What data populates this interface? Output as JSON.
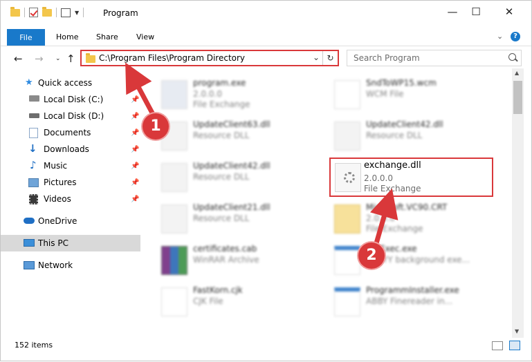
{
  "window": {
    "title": "Program",
    "controls": [
      "minimize-icon",
      "maximize-icon",
      "close-icon"
    ]
  },
  "ribbon": {
    "tabs": [
      "File",
      "Home",
      "Share",
      "View"
    ],
    "file_color": "#1979ca"
  },
  "address": {
    "path": "C:\\Program Files\\Program Directory",
    "highlight_color": "#d9383a"
  },
  "search": {
    "placeholder": "Search Program"
  },
  "nav": {
    "items": [
      {
        "label": "Quick access",
        "icon": "star-icon"
      },
      {
        "label": "Local Disk (C:)",
        "icon": "drive-icon",
        "pinned": true
      },
      {
        "label": "Local Disk (D:)",
        "icon": "drive-icon",
        "pinned": true
      },
      {
        "label": "Documents",
        "icon": "documents-icon",
        "pinned": true
      },
      {
        "label": "Downloads",
        "icon": "download-arrow-icon",
        "pinned": true
      },
      {
        "label": "Music",
        "icon": "music-note-icon",
        "pinned": true
      },
      {
        "label": "Pictures",
        "icon": "pictures-icon",
        "pinned": true
      },
      {
        "label": "Videos",
        "icon": "film-icon",
        "pinned": true
      },
      {
        "label": "OneDrive",
        "icon": "cloud-icon"
      },
      {
        "label": "This PC",
        "icon": "monitor-icon",
        "selected": true
      },
      {
        "label": "Network",
        "icon": "network-icon"
      }
    ]
  },
  "files": {
    "left": [
      {
        "name": "program.exe",
        "sub1": "2.0.0.0",
        "sub2": "File Exchange"
      },
      {
        "name": "UpdateClient63.dll",
        "sub1": "Resource DLL",
        "sub2": ""
      },
      {
        "name": "UpdateClient42.dll",
        "sub1": "Resource DLL",
        "sub2": ""
      },
      {
        "name": "UpdateClient21.dll",
        "sub1": "Resource DLL",
        "sub2": ""
      },
      {
        "name": "certificates.cab",
        "sub1": "WinRAR Archive",
        "sub2": ""
      },
      {
        "name": "FastKorn.cjk",
        "sub1": "CJK File",
        "sub2": ""
      }
    ],
    "right": [
      {
        "name": "SndToWP15.wcm",
        "sub1": "WCM File",
        "sub2": ""
      },
      {
        "name": "UpdateClient42.dll",
        "sub1": "Resource DLL",
        "sub2": ""
      },
      {
        "name": "Microsoft.VC90.CRT",
        "sub1": "2.0.0.0",
        "sub2": "File Exchange"
      },
      {
        "name": "FileExec.exe",
        "sub1": "ABBYY background exe...",
        "sub2": ""
      },
      {
        "name": "ProgrammInstaller.exe",
        "sub1": "ABBY Finereader in...",
        "sub2": ""
      }
    ],
    "highlighted": {
      "name": "exchange.dll",
      "sub1": "2.0.0.0",
      "sub2": "File Exchange"
    }
  },
  "status": {
    "count": "152 items"
  },
  "annotations": {
    "step1": "1",
    "step2": "2"
  }
}
